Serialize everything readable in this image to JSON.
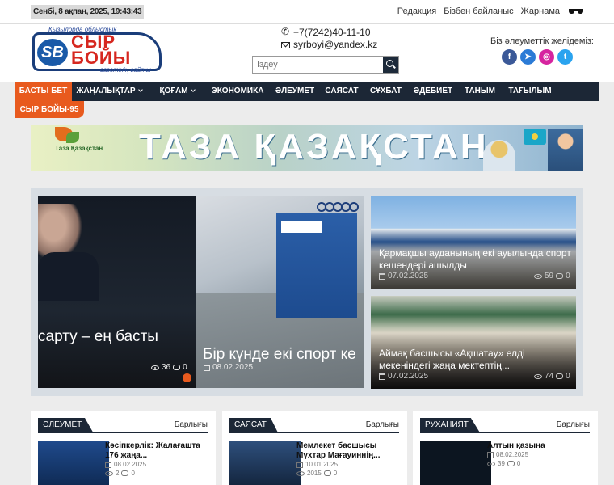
{
  "topbar": {
    "date": "Сенбі, 8 ақпан, 2025, 19:43:43",
    "links": [
      "Редакция",
      "Бізбен байланыс",
      "Жарнама"
    ]
  },
  "logo": {
    "sup": "Қызылорда облыстық",
    "mark": "SB",
    "name_line1": "СЫР",
    "name_line2": "БОЙЫ",
    "sub": "газетінің сайты"
  },
  "contacts": {
    "phone": "+7(7242)40-11-10",
    "email": "syrboyi@yandex.kz"
  },
  "search": {
    "placeholder": "Іздеу"
  },
  "social": {
    "label": "Біз әлеуметтік желідеміз:",
    "icons": [
      {
        "name": "facebook-icon",
        "glyph": "f",
        "color": "#3b5998"
      },
      {
        "name": "telegram-icon",
        "glyph": "➤",
        "color": "#2b7bd6"
      },
      {
        "name": "instagram-icon",
        "glyph": "◎",
        "color": "#d6249f"
      },
      {
        "name": "twitter-icon",
        "glyph": "t",
        "color": "#2aa3ef"
      }
    ]
  },
  "nav": {
    "items": [
      {
        "label": "БАСТЫ БЕТ",
        "active": true,
        "caret": false
      },
      {
        "label": "ЖАҢАЛЫҚТАР",
        "active": false,
        "caret": true
      },
      {
        "label": "ҚОҒАМ",
        "active": false,
        "caret": true
      },
      {
        "label": "ЭКОНОМИКА",
        "active": false,
        "caret": false
      },
      {
        "label": "ӘЛЕУМЕТ",
        "active": false,
        "caret": false
      },
      {
        "label": "САЯСАТ",
        "active": false,
        "caret": false
      },
      {
        "label": "СҰХБАТ",
        "active": false,
        "caret": false
      },
      {
        "label": "ӘДЕБИЕТ",
        "active": false,
        "caret": false
      },
      {
        "label": "ТАНЫМ",
        "active": false,
        "caret": false
      },
      {
        "label": "ТАҒЫЛЫМ",
        "active": false,
        "caret": false
      }
    ],
    "second_row": "СЫР БОЙЫ-95"
  },
  "banner": {
    "text": "ТАЗА ҚАЗАҚСТАН",
    "logo_text": "Таза Қазақстан"
  },
  "slider": {
    "title_a": "сарту – ең басты",
    "title_b": "Бір күнде екі спорт ке",
    "views_a": "36",
    "comments_a": "0",
    "date_b": "08.02.2025",
    "accent": "#e85a1e"
  },
  "side_cards": [
    {
      "title": "Қармақшы ауданының екі ауылында спорт кешендері ашылды",
      "date": "07.02.2025",
      "views": "59",
      "comments": "0"
    },
    {
      "title": "Аймақ басшысы «Ақшатау» елді мекеніндегі жаңа мектептің...",
      "date": "07.02.2025",
      "views": "74",
      "comments": "0"
    }
  ],
  "columns": [
    {
      "tab": "ӘЛЕУМЕТ",
      "all": "Барлығы",
      "title": "Кәсіпкерлік: Жалағашта 176 жаңа...",
      "date": "08.02.2025",
      "views": "2",
      "comments": "0"
    },
    {
      "tab": "САЯСАТ",
      "all": "Барлығы",
      "title": "Мемлекет басшысы Мұхтар Мағауиннің...",
      "date": "10.01.2025",
      "views": "2015",
      "comments": "0"
    },
    {
      "tab": "РУХАНИЯТ",
      "all": "Барлығы",
      "title": "Алтын қазына",
      "date": "08.02.2025",
      "views": "39",
      "comments": "0"
    }
  ]
}
